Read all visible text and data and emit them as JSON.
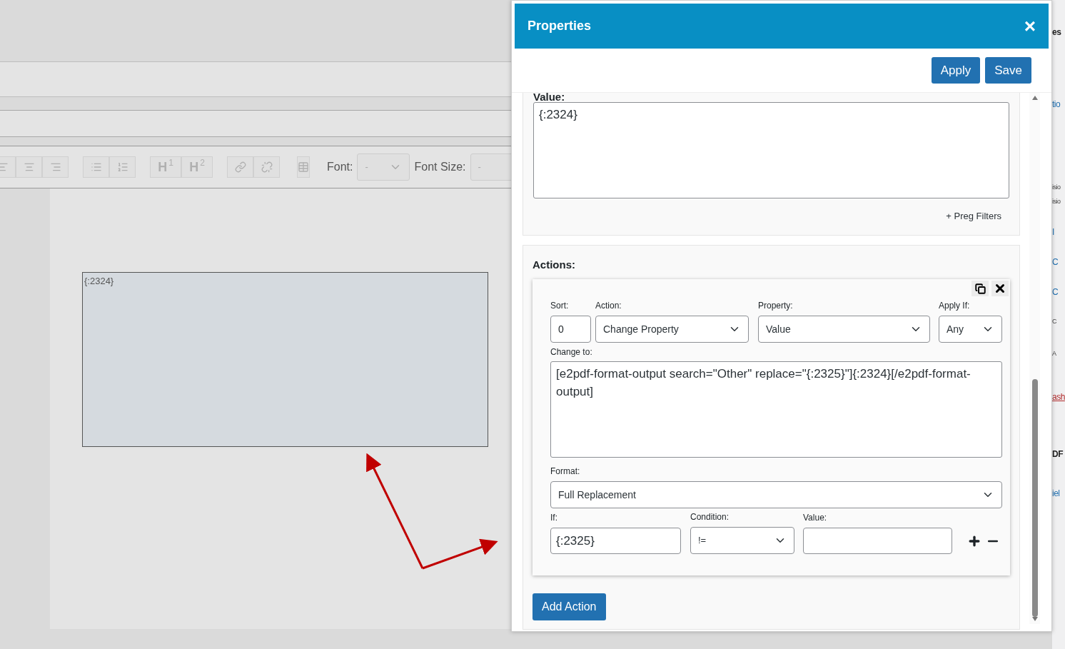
{
  "editor": {
    "headings": [
      {
        "letter": "H",
        "number": "1"
      },
      {
        "letter": "H",
        "number": "2"
      }
    ],
    "font_label": "Font:",
    "font_value": "-",
    "font_size_label": "Font Size:",
    "font_size_value": "-",
    "field_text": "{:2324}"
  },
  "dialog": {
    "title": "Properties",
    "close": "×",
    "buttons": [
      "Apply",
      "Save"
    ],
    "value_label": "Value:",
    "value": "{:2324}",
    "preg_filters": "+ Preg Filters",
    "actions_label": "Actions:",
    "action": {
      "sort_label": "Sort:",
      "sort": "0",
      "action_label": "Action:",
      "action": "Change Property",
      "property_label": "Property:",
      "property": "Value",
      "apply_if_label": "Apply If:",
      "apply_if": "Any",
      "change_to_label": "Change to:",
      "change_to": "[e2pdf-format-output search=\"Other\" replace=\"{:2325}\"]{:2324}[/e2pdf-format-output]",
      "format_label": "Format:",
      "format": "Full Replacement",
      "if_label": "If:",
      "if": "{:2325}",
      "condition_label": "Condition:",
      "condition": "!=",
      "value_label": "Value:"
    },
    "add_action": "Add Action"
  },
  "behind_panel": [
    {
      "kind": "heading",
      "text": "es"
    },
    {
      "kind": "link",
      "text": "tio"
    },
    {
      "kind": "text",
      "text": "isio"
    },
    {
      "kind": "text",
      "text": "isio"
    },
    {
      "kind": "link",
      "text": "I"
    },
    {
      "kind": "link",
      "text": "C"
    },
    {
      "kind": "link",
      "text": "C"
    },
    {
      "kind": "text",
      "text": "C"
    },
    {
      "kind": "text",
      "text": "A"
    },
    {
      "kind": "danger",
      "text": "ash"
    },
    {
      "kind": "heading",
      "text": "DF"
    },
    {
      "kind": "link",
      "text": "iel"
    }
  ]
}
